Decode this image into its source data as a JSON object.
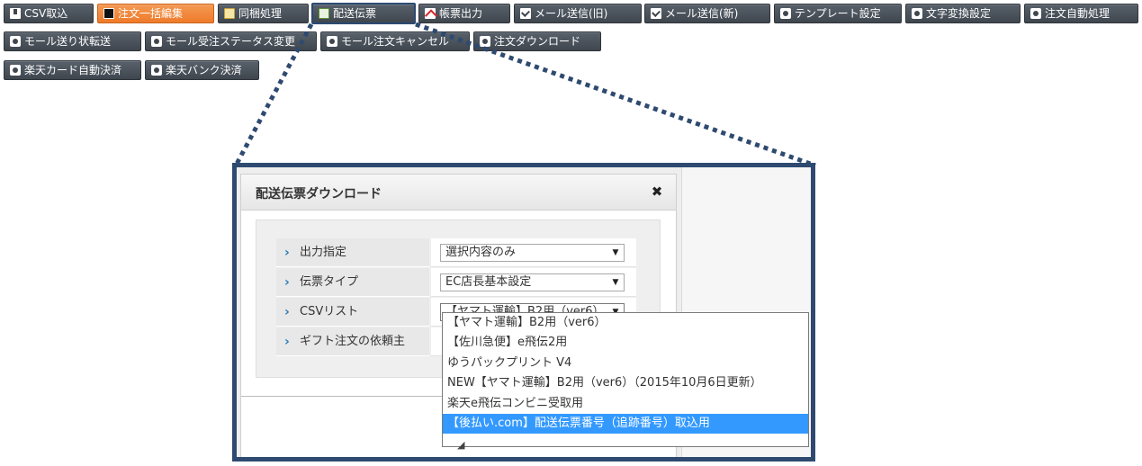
{
  "toolbar": {
    "row1": [
      {
        "label": "CSV取込",
        "icon": "download-icon"
      },
      {
        "label": "注文一括編集",
        "icon": "edit-icon"
      },
      {
        "label": "同梱処理",
        "icon": "list-icon"
      },
      {
        "label": "配送伝票",
        "icon": "truck-icon"
      },
      {
        "label": "帳票出力",
        "icon": "pdf-icon"
      },
      {
        "label": "メール送信(旧)",
        "icon": "mail-icon"
      },
      {
        "label": "メール送信(新)",
        "icon": "mail-icon"
      },
      {
        "label": "テンプレート設定",
        "icon": "gear-icon"
      },
      {
        "label": "文字変換設定",
        "icon": "gear-icon"
      },
      {
        "label": "注文自動処理",
        "icon": "gear-icon"
      }
    ],
    "row2": [
      {
        "label": "モール送り状転送",
        "icon": "gear-icon"
      },
      {
        "label": "モール受注ステータス変更",
        "icon": "gear-icon"
      },
      {
        "label": "モール注文キャンセル",
        "icon": "gear-icon"
      },
      {
        "label": "注文ダウンロード",
        "icon": "gear-icon"
      }
    ],
    "row3": [
      {
        "label": "楽天カード自動決済",
        "icon": "gear-icon"
      },
      {
        "label": "楽天バンク決済",
        "icon": "gear-icon"
      }
    ]
  },
  "dialog": {
    "title": "配送伝票ダウンロード",
    "close_icon": "close-icon",
    "fields": [
      {
        "label": "出力指定",
        "value": "選択内容のみ"
      },
      {
        "label": "伝票タイプ",
        "value": "EC店長基本設定"
      },
      {
        "label": "CSVリスト",
        "value": "【ヤマト運輸】B2用（ver6）"
      },
      {
        "label": "ギフト注文の依頼主",
        "value": ""
      }
    ],
    "csv_options": [
      "【ヤマト運輸】B2用（ver6）",
      "【佐川急便】e飛伝2用",
      "ゆうパックプリント V4",
      "NEW【ヤマト運輸】B2用（ver6）（2015年10月6日更新）",
      "楽天e飛伝コンビニ受取用",
      "【後払い.com】配送伝票番号（追跡番号）取込用"
    ],
    "csv_highlighted_index": 5
  },
  "colors": {
    "toolbar_button": "#4a5159",
    "toolbar_active": "#ee7b2a",
    "frame_border": "#2e4a70",
    "highlight": "#3399ff",
    "chevron": "#2a7db7"
  }
}
